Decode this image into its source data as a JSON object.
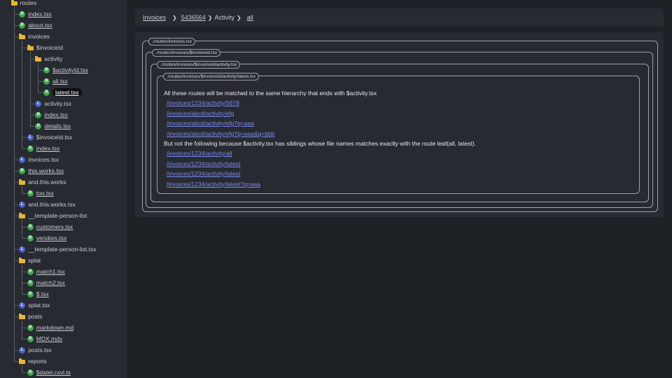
{
  "sidebar": {
    "tree": [
      {
        "indent": 1,
        "kind": "folder",
        "label": "routes",
        "link": false
      },
      {
        "indent": 2,
        "kind": "r",
        "label": "index.tsx",
        "link": true
      },
      {
        "indent": 2,
        "kind": "r",
        "label": "about.tsx",
        "link": true
      },
      {
        "indent": 2,
        "kind": "folder",
        "label": "invoices",
        "link": false
      },
      {
        "indent": 3,
        "kind": "folder",
        "label": "$invoiceId",
        "link": false
      },
      {
        "indent": 4,
        "kind": "folder",
        "label": "activity",
        "link": false
      },
      {
        "indent": 5,
        "kind": "r",
        "label": "$activityId.tsx",
        "link": true
      },
      {
        "indent": 5,
        "kind": "r",
        "label": "all.tsx",
        "link": true
      },
      {
        "indent": 5,
        "kind": "r",
        "label": "latest.tsx",
        "link": true,
        "active": true
      },
      {
        "indent": 4,
        "kind": "l",
        "label": "activity.tsx",
        "link": false
      },
      {
        "indent": 4,
        "kind": "r",
        "label": "index.tsx",
        "link": true
      },
      {
        "indent": 4,
        "kind": "r",
        "label": "details.tsx",
        "link": true
      },
      {
        "indent": 3,
        "kind": "l",
        "label": "$invoiceId.tsx",
        "link": false
      },
      {
        "indent": 3,
        "kind": "r",
        "label": "index.tsx",
        "link": true
      },
      {
        "indent": 2,
        "kind": "l",
        "label": "invoices.tsx",
        "link": false
      },
      {
        "indent": 2,
        "kind": "r",
        "label": "this.works.tsx",
        "link": true
      },
      {
        "indent": 2,
        "kind": "folder",
        "label": "and.this.works",
        "link": false
      },
      {
        "indent": 3,
        "kind": "r",
        "label": "too.tsx",
        "link": true
      },
      {
        "indent": 2,
        "kind": "l",
        "label": "and.this.works.tsx",
        "link": false
      },
      {
        "indent": 2,
        "kind": "folder",
        "label": "__template-person-list",
        "link": false
      },
      {
        "indent": 3,
        "kind": "r",
        "label": "customers.tsx",
        "link": true
      },
      {
        "indent": 3,
        "kind": "r",
        "label": "vendors.tsx",
        "link": true
      },
      {
        "indent": 2,
        "kind": "l",
        "label": "__template-person-list.tsx",
        "link": false
      },
      {
        "indent": 2,
        "kind": "folder",
        "label": "splat",
        "link": false
      },
      {
        "indent": 3,
        "kind": "r",
        "label": "match1.tsx",
        "link": true
      },
      {
        "indent": 3,
        "kind": "r",
        "label": "match2.tsx",
        "link": true
      },
      {
        "indent": 3,
        "kind": "r",
        "label": "$.tsx",
        "link": true
      },
      {
        "indent": 2,
        "kind": "l",
        "label": "splat.tsx",
        "link": false
      },
      {
        "indent": 2,
        "kind": "folder",
        "label": "posts",
        "link": false
      },
      {
        "indent": 3,
        "kind": "r",
        "label": "markdown.md",
        "link": true
      },
      {
        "indent": 3,
        "kind": "r",
        "label": "MDX.mdx",
        "link": true
      },
      {
        "indent": 2,
        "kind": "l",
        "label": "posts.tsx",
        "link": false
      },
      {
        "indent": 2,
        "kind": "folder",
        "label": "reports",
        "link": false
      },
      {
        "indent": 3,
        "kind": "r",
        "label": "$datel.csvl.ts",
        "link": true
      }
    ],
    "icon_letters": {
      "r": "R",
      "l": "L"
    }
  },
  "breadcrumb": {
    "invoices": "Invoices",
    "sep1": "❯",
    "invoice_id": "5436564",
    "sep2": "❯",
    "activity": "Activity",
    "sep3": "❯",
    "all": "all"
  },
  "panel": {
    "boxes": [
      "./routes/invoices.tsx",
      "./routes/invoices/$invoiceId.tsx",
      "./routes/invoices/$invoiceId/activity.tsx",
      "./routes/invoices/$invoiceId/activity/latest.tsx"
    ],
    "intro_text": "All these routes will be matched to the same hierarchy that ends with $activity.tsx",
    "matched_links": [
      "/invoices/1234/activity/5678",
      "/invoices/abcd/activity/efg",
      "/invoices/abcd/activity/efg?q=aaa",
      "/invoices/abcd/activity/efg?q=aaa&q=bbb"
    ],
    "not_text": "But not the following because $activity.tsx has siblings whose file names matches exaclty with the route leaf(all, latest).",
    "unmatched_links": [
      "/invoices/1234/activity/all",
      "/invoices/1234/activity/latest",
      "/invoices/1234/activity/latest",
      "/invoices/1234/activity/latest?q=aaa"
    ]
  },
  "colors": {
    "background": "#1e2125",
    "surface": "#272a30",
    "link_accent": "#7b8bf0",
    "route_icon": "#3fa34d",
    "layout_icon": "#4d62c9",
    "folder_icon": "#e8b730"
  }
}
